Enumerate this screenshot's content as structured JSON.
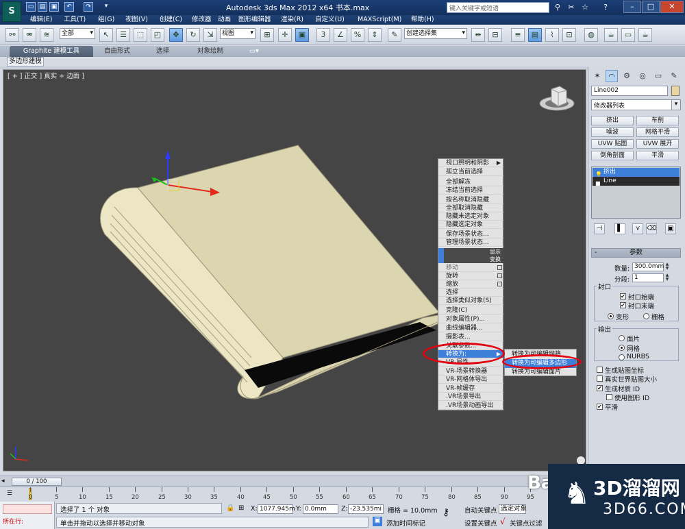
{
  "title_bar": {
    "logo_text": "S",
    "title": "Autodesk 3ds Max  2012 x64      书本.max",
    "search_placeholder": "键入关键字或短语",
    "quick_access": [
      "new-icon",
      "open-icon",
      "save-icon",
      "undo-icon",
      "redo-icon",
      "dropdown-icon"
    ],
    "right_icons": [
      "binoculars-icon",
      "star-icon",
      "help-icon"
    ]
  },
  "menu_bar": {
    "items": [
      "编辑(E)",
      "工具(T)",
      "组(G)",
      "视图(V)",
      "创建(C)",
      "修改器",
      "动画",
      "图形编辑器",
      "渲染(R)",
      "自定义(U)",
      "MAXScript(M)",
      "帮助(H)"
    ]
  },
  "toolbar": {
    "filter_value": "全部",
    "coord_system": "视图",
    "named_selection": "创建选择集"
  },
  "ribbon": {
    "tabs": [
      "Graphite 建模工具",
      "自由形式",
      "选择",
      "对象绘制"
    ],
    "sub_tab": "多边形建模"
  },
  "viewport": {
    "label": "[ + ] 正交 ] 真实 + 边面 ]"
  },
  "quad_menu": {
    "group1": [
      "视口照明和阴影",
      "孤立当前选择",
      "全部解冻",
      "冻结当前选择",
      "按名称取消隐藏",
      "全部取消隐藏",
      "隐藏未选定对象",
      "隐藏选定对象",
      "保存场景状态...",
      "管理场景状态..."
    ],
    "header1": "显示",
    "header2": "变换",
    "group2": [
      "移动",
      "旋转",
      "缩放",
      "选择",
      "选择类似对象(S)",
      "克隆(C)",
      "对象属性(P)...",
      "曲线编辑器...",
      "摄影表...",
      "关联参数...",
      "转换为:",
      "VR-属性",
      "VR-场景转换器",
      "VR-网格体导出",
      "VR-帧缓存",
      ".VR场景导出",
      ".VR场景动画导出"
    ]
  },
  "convert_submenu": {
    "items": [
      "转换为可编辑网格",
      "转换为可编辑多边形",
      "转换为可编辑面片"
    ]
  },
  "command_panel": {
    "object_name": "Line002",
    "object_color": "#e8d79e",
    "modifier_list": "修改器列表",
    "modifier_buttons": [
      "挤出",
      "车削",
      "噪波",
      "网格平滑",
      "UVW 贴图",
      "UVW 展开",
      "倒角剖面",
      "平滑"
    ],
    "stack": [
      "挤出",
      "Line"
    ],
    "rollout_title": "参数",
    "amount_label": "数量:",
    "amount_value": "300.0mm",
    "segments_label": "分段:",
    "segments_value": "1",
    "capping_title": "封口",
    "cap_start": "封口始端",
    "cap_end": "封口末端",
    "morph": "变形",
    "grid": "栅格",
    "output_title": "输出",
    "out_patch": "面片",
    "out_mesh": "网格",
    "out_nurbs": "NURBS",
    "gen_map_coords": "生成贴图坐标",
    "real_world": "真实世界贴图大小",
    "gen_mat_ids": "生成材质 ID",
    "use_shape_ids": "使用图形 ID",
    "smooth": "平滑"
  },
  "timeline": {
    "slider": "0 / 100",
    "ticks": [
      "0",
      "5",
      "10",
      "15",
      "20",
      "25",
      "30",
      "35",
      "40",
      "45",
      "50",
      "55",
      "60",
      "65",
      "70",
      "75",
      "80",
      "85",
      "90",
      "95"
    ]
  },
  "status": {
    "mini_listener": "所在行:",
    "selection_info": "选择了 1 个 对象",
    "prompt": "单击并拖动以选择并移动对象",
    "x_label": "X:",
    "x_value": "1077.945m",
    "y_label": "Y:",
    "y_value": "0.0mm",
    "z_label": "Z:",
    "z_value": "-23.535mi",
    "grid": "栅格 = 10.0mm",
    "auto_key": "自动关键点",
    "selected": "选定对象",
    "set_key": "设置关键点",
    "key_filters": "关键点过滤",
    "add_time_tag": "添加时间标记"
  },
  "watermark": {
    "title": "3D溜溜网",
    "url": "3D66.COM",
    "partial": "Ba"
  }
}
